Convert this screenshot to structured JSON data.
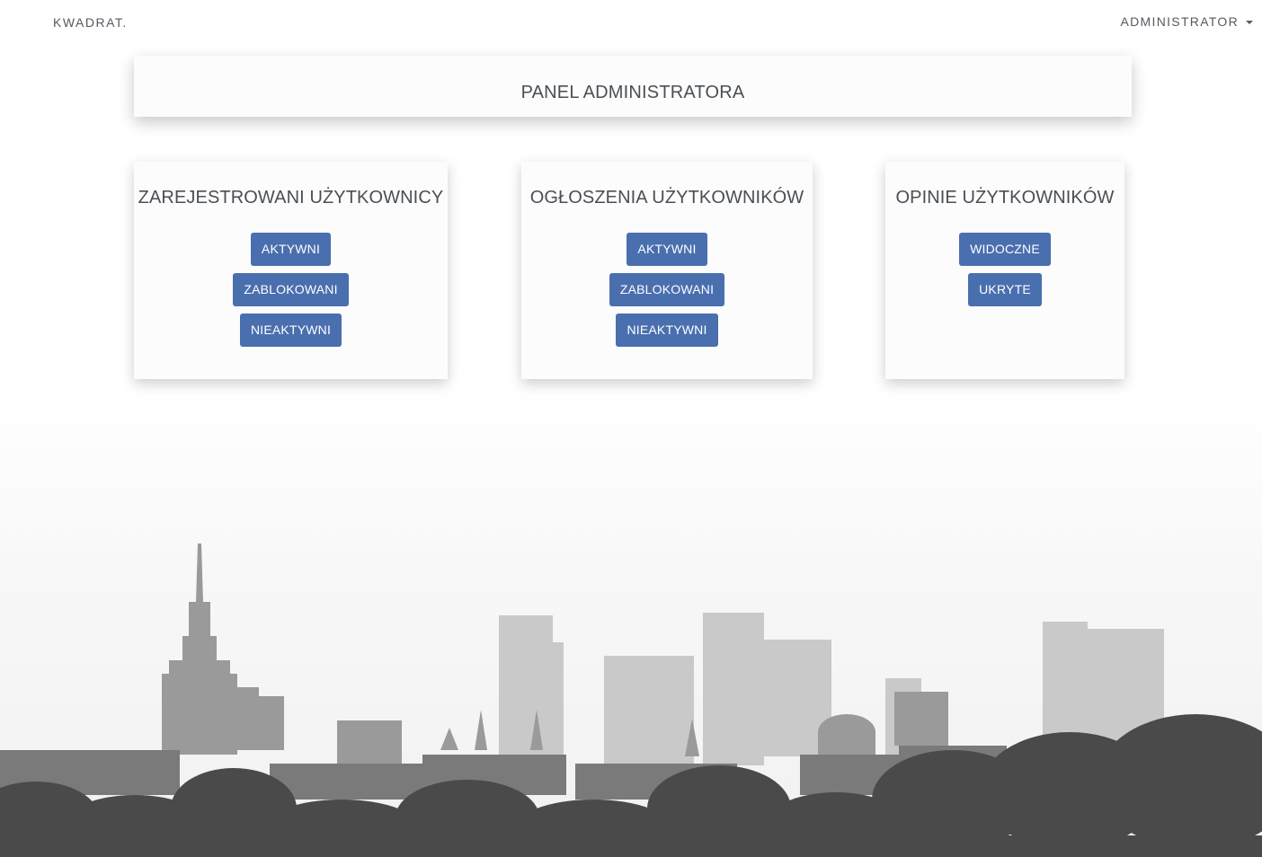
{
  "navbar": {
    "brand": "KWADRAT.",
    "user_menu": "ADMINISTRATOR",
    "user_menu_icon": "caret-down-icon"
  },
  "header": {
    "title": "PANEL ADMINISTRATORA"
  },
  "cards": [
    {
      "title": "ZAREJESTROWANI UŻYTKOWNICY",
      "buttons": [
        "AKTYWNI",
        "ZABLOKOWANI",
        "NIEAKTYWNI"
      ]
    },
    {
      "title": "OGŁOSZENIA UŻYTKOWNIKÓW",
      "buttons": [
        "AKTYWNI",
        "ZABLOKOWANI",
        "NIEAKTYWNI"
      ]
    },
    {
      "title": "OPINIE UŻYTKOWNIKÓW",
      "buttons": [
        "WIDOCZNE",
        "UKRYTE"
      ]
    }
  ],
  "colors": {
    "button": "#4a6faf",
    "text": "#4a4f55",
    "card_background": "#fcfcfc"
  },
  "background_image": "warsaw-skyline-grayscale"
}
